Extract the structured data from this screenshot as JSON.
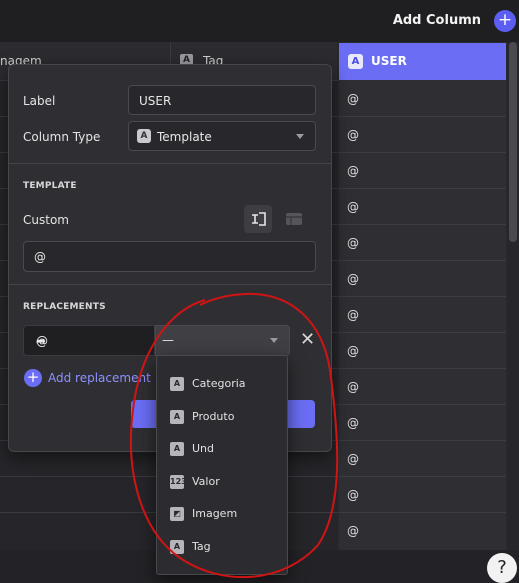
{
  "toolbar": {
    "add_column_label": "Add Column",
    "add_icon": "+"
  },
  "columns": {
    "left_header_fragment": "nagem",
    "tag_header": "Tag",
    "tag_icon_letter": "A",
    "user_header": "USER",
    "user_icon_letter": "A"
  },
  "user_cells": [
    "@",
    "@",
    "@",
    "@",
    "@",
    "@",
    "@",
    "@",
    "@",
    "@",
    "@",
    "@",
    "@"
  ],
  "panel": {
    "label_caption": "Label",
    "label_value": "USER",
    "column_type_caption": "Column Type",
    "column_type_value": "Template",
    "column_type_icon_letter": "A",
    "template_section": "TEMPLATE",
    "custom_caption": "Custom",
    "template_value": "@",
    "replacements_section": "REPLACEMENTS",
    "replacement_key": "@",
    "replacement_arrow": "➦",
    "replacement_selected": "—",
    "close_icon": "✕",
    "add_replacement_label": "Add replacement",
    "add_replacement_icon": "+"
  },
  "dropdown": {
    "options": [
      {
        "label": "Categoria",
        "icon": "A"
      },
      {
        "label": "Produto",
        "icon": "A"
      },
      {
        "label": "Und",
        "icon": "A"
      },
      {
        "label": "Valor",
        "icon": "123"
      },
      {
        "label": "Imagem",
        "icon": "◩"
      },
      {
        "label": "Tag",
        "icon": "A"
      }
    ]
  },
  "help": {
    "label": "?"
  },
  "colors": {
    "accent": "#6b6ef5",
    "annotation": "#d01414"
  }
}
